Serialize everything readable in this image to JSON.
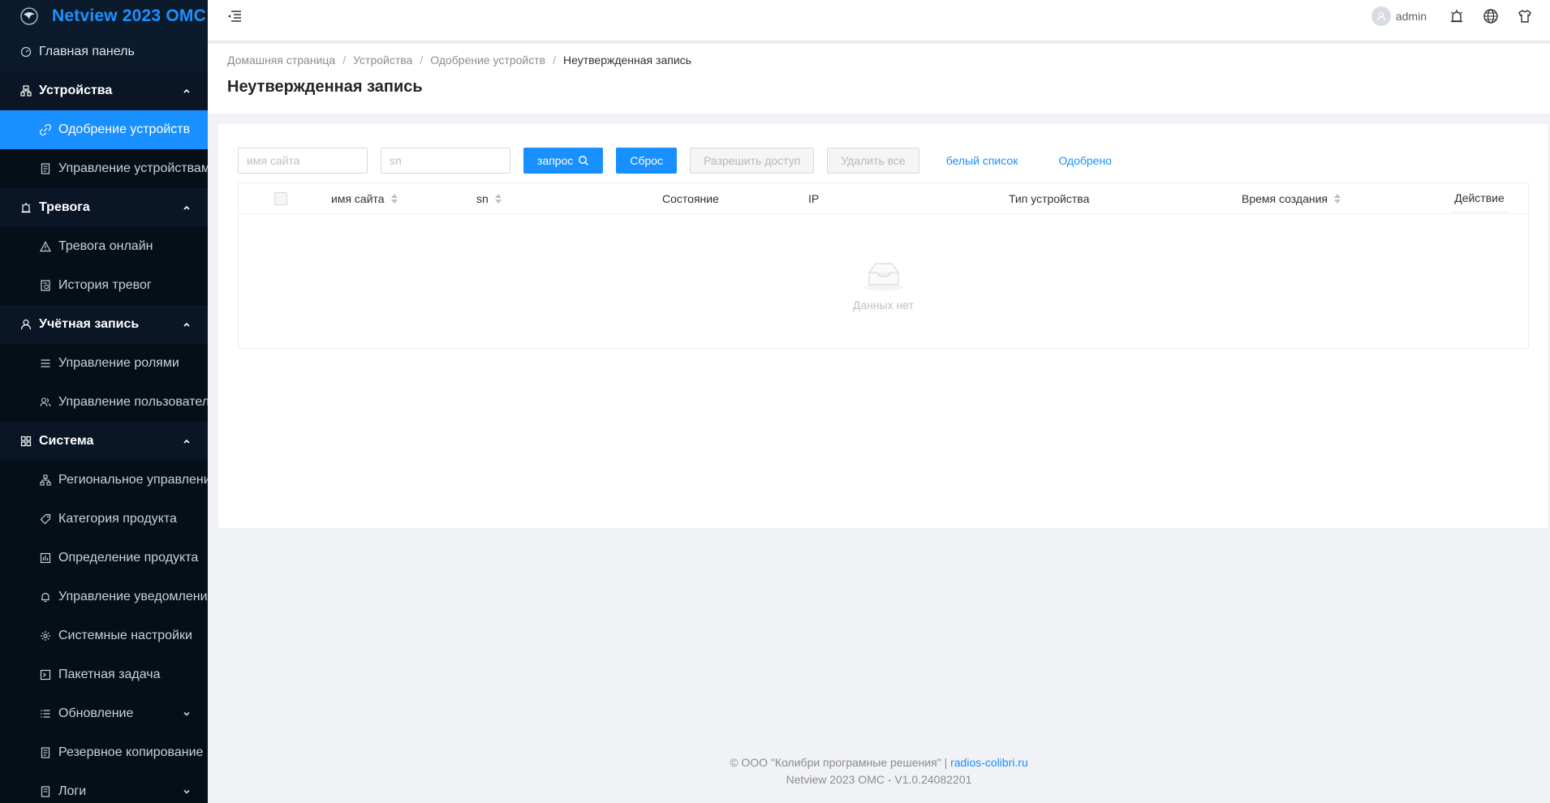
{
  "app": {
    "title": "Netview 2023 OMC"
  },
  "colors": {
    "accent": "#1890ff",
    "sidebar_bg": "#0b1b2c"
  },
  "sidebar": {
    "dashboard": "Главная панель",
    "devices": {
      "label": "Устройства",
      "items": [
        "Одобрение устройств",
        "Управление устройствами"
      ]
    },
    "alarm": {
      "label": "Тревога",
      "items": [
        "Тревога онлайн",
        "История тревог"
      ]
    },
    "account": {
      "label": "Учётная запись",
      "items": [
        "Управление ролями",
        "Управление пользователями"
      ]
    },
    "system": {
      "label": "Система",
      "items": [
        "Региональное управление",
        "Категория продукта",
        "Определение продукта",
        "Управление уведомлениями",
        "Системные настройки",
        "Пакетная задача",
        "Обновление",
        "Резервное копирование",
        "Логи"
      ]
    }
  },
  "header": {
    "user": "admin"
  },
  "breadcrumb": [
    "Домашняя страница",
    "Устройства",
    "Одобрение устройств",
    "Неутвержденная запись"
  ],
  "page": {
    "title": "Неутвержденная запись"
  },
  "filters": {
    "site_placeholder": "имя сайта",
    "sn_placeholder": "sn",
    "query": "запрос",
    "reset": "Сброс",
    "allow": "Разрешить доступ",
    "delete_all": "Удалить все",
    "whitelist": "белый список",
    "approved": "Одобрено"
  },
  "table": {
    "columns": [
      "имя сайта",
      "sn",
      "Состояние",
      "IP",
      "Тип устройства",
      "Время создания",
      "Действие"
    ],
    "empty": "Данных нет"
  },
  "footer": {
    "copyright": "© ООО \"Колибри програмные решения\" |",
    "link": "radios-colibri.ru",
    "version": "Netview 2023 OMC - V1.0.24082201"
  }
}
